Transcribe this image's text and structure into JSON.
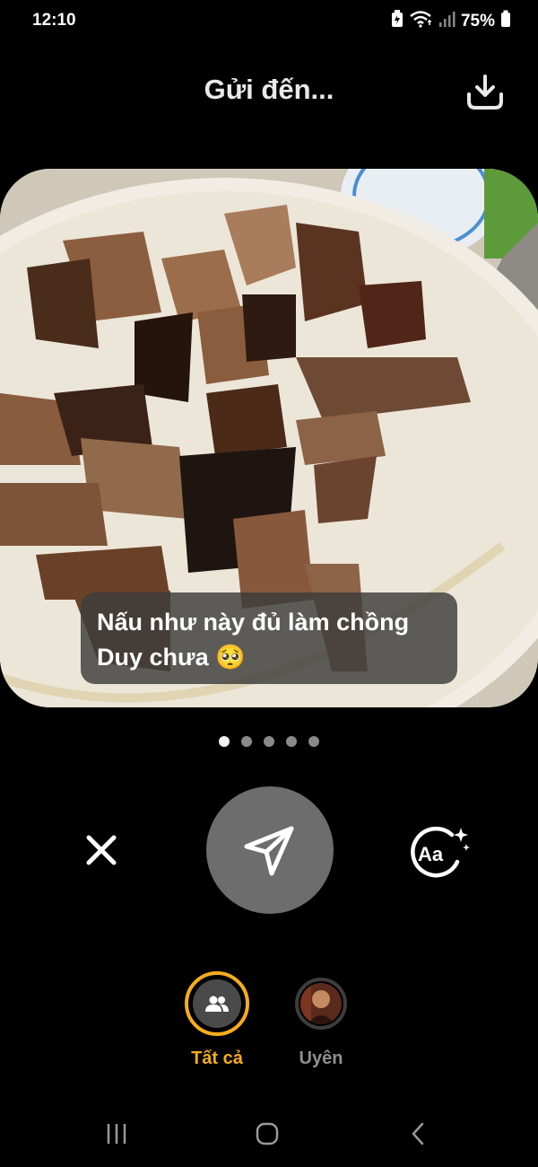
{
  "status_bar": {
    "time": "12:10",
    "battery_percent": "75%",
    "icons": [
      "battery-saver-icon",
      "wifi-icon",
      "signal-icon",
      "battery-icon"
    ]
  },
  "header": {
    "title": "Gửi đến...",
    "download_icon": "download-icon"
  },
  "photo": {
    "description_icon": "food-photo",
    "caption": "Nấu như này đủ làm chồng Duy chưa 🥺"
  },
  "pager": {
    "total": 5,
    "active_index": 0
  },
  "actions": {
    "close_icon": "close-icon",
    "send_icon": "send-icon",
    "text_style_icon": "text-effects-icon",
    "text_style_glyph": "Aa"
  },
  "recipients": [
    {
      "label": "Tất cả",
      "icon": "group-icon",
      "selected": true
    },
    {
      "label": "Uyên",
      "icon": "avatar",
      "selected": false
    }
  ],
  "navbar": {
    "icons": [
      "recents-icon",
      "home-icon",
      "back-icon"
    ]
  },
  "colors": {
    "accent": "#f5ad1b",
    "background": "#000000",
    "send_button": "#6d6d6d"
  }
}
